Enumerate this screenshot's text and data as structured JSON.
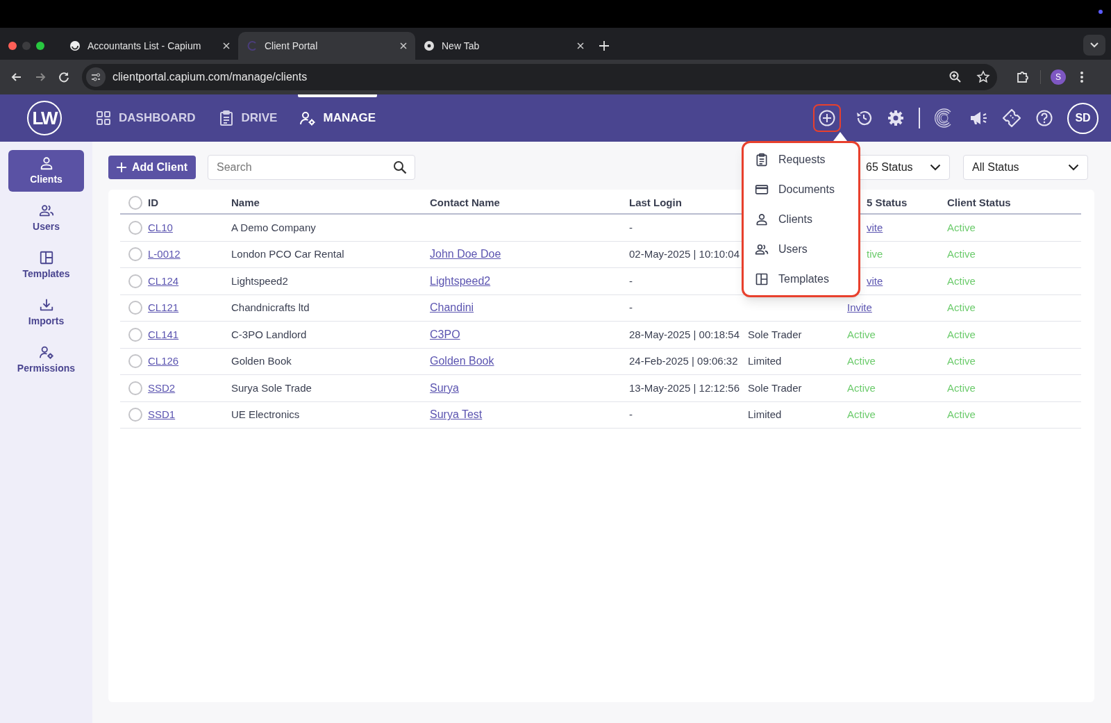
{
  "browser": {
    "tabs": [
      {
        "title": "Accountants List - Capium",
        "selected": false,
        "kind": "capium"
      },
      {
        "title": "Client Portal",
        "selected": true,
        "kind": "portal"
      },
      {
        "title": "New Tab",
        "selected": false,
        "kind": "chrome"
      }
    ],
    "url": "clientportal.capium.com/manage/clients",
    "profile": "S"
  },
  "header": {
    "logo": "LW",
    "nav": [
      {
        "label": "DASHBOARD",
        "selected": false,
        "kind": "grid"
      },
      {
        "label": "DRIVE",
        "selected": false,
        "kind": "clipboard"
      },
      {
        "label": "MANAGE",
        "selected": true,
        "kind": "user-gear"
      }
    ],
    "avatar": "SD",
    "add_highlighted": true
  },
  "add_menu": {
    "items": [
      {
        "label": "Requests",
        "kind": "clipboard"
      },
      {
        "label": "Documents",
        "kind": "card"
      },
      {
        "label": "Clients",
        "kind": "user"
      },
      {
        "label": "Users",
        "kind": "users"
      },
      {
        "label": "Templates",
        "kind": "layout"
      }
    ]
  },
  "sidebar": {
    "items": [
      {
        "label": "Clients",
        "selected": true,
        "kind": "user"
      },
      {
        "label": "Users",
        "selected": false,
        "kind": "users"
      },
      {
        "label": "Templates",
        "selected": false,
        "kind": "layout"
      },
      {
        "label": "Imports",
        "selected": false,
        "kind": "download"
      },
      {
        "label": "Permissions",
        "selected": false,
        "kind": "user-gear"
      }
    ]
  },
  "toolbar": {
    "add_button": "Add Client",
    "search": {
      "placeholder": "Search"
    },
    "filters": [
      {
        "label": "65 Status",
        "cut": true
      },
      {
        "label": "All Status",
        "cut": false
      }
    ]
  },
  "table": {
    "header": {
      "select_all_checked": false,
      "id": "ID",
      "name": "Name",
      "contact_name": "Contact Name",
      "last_login": "Last Login",
      "status_365": {
        "text": "5 Status",
        "cut": true
      },
      "client_status": "Client Status"
    },
    "rows": [
      {
        "checked": false,
        "id": "CL10",
        "name": "A Demo Company",
        "last_login": "-",
        "status_365": {
          "text": "vite",
          "kind": "link",
          "cut": true
        },
        "client_status": "Active"
      },
      {
        "checked": false,
        "id": "L-0012",
        "name": "London PCO Car Rental",
        "contact_name": "John Doe Doe",
        "last_login": "02-May-2025 | 10:10:04",
        "status_365": {
          "text": "tive",
          "kind": "status",
          "cut": true
        },
        "client_status": "Active"
      },
      {
        "checked": false,
        "id": "CL124",
        "name": "Lightspeed2",
        "contact_name": "Lightspeed2",
        "last_login": "-",
        "status_365": {
          "text": "vite",
          "kind": "link",
          "cut": true
        },
        "client_status": "Active"
      },
      {
        "checked": false,
        "id": "CL121",
        "name": "Chandnicrafts ltd",
        "contact_name": "Chandini",
        "last_login": "-",
        "status_365": {
          "text": "Invite",
          "kind": "link",
          "cut": false
        },
        "client_status": "Active"
      },
      {
        "checked": false,
        "id": "CL141",
        "name": "C-3PO Landlord",
        "contact_name": "C3PO",
        "last_login": "28-May-2025 | 00:18:54",
        "type": "Sole Trader",
        "status_365": {
          "text": "Active",
          "kind": "status"
        },
        "client_status": "Active"
      },
      {
        "checked": false,
        "id": "CL126",
        "name": "Golden Book",
        "contact_name": "Golden Book",
        "last_login": "24-Feb-2025 | 09:06:32",
        "type": "Limited",
        "status_365": {
          "text": "Active",
          "kind": "status"
        },
        "client_status": "Active"
      },
      {
        "checked": false,
        "id": "SSD2",
        "name": "Surya Sole Trade",
        "contact_name": "Surya",
        "last_login": "13-May-2025 | 12:12:56",
        "type": "Sole Trader",
        "status_365": {
          "text": "Active",
          "kind": "status"
        },
        "client_status": "Active"
      },
      {
        "checked": false,
        "id": "SSD1",
        "name": "UE Electronics",
        "contact_name": "Surya Test",
        "last_login": "-",
        "type": "Limited",
        "status_365": {
          "text": "Active",
          "kind": "status"
        },
        "client_status": "Active"
      }
    ]
  }
}
